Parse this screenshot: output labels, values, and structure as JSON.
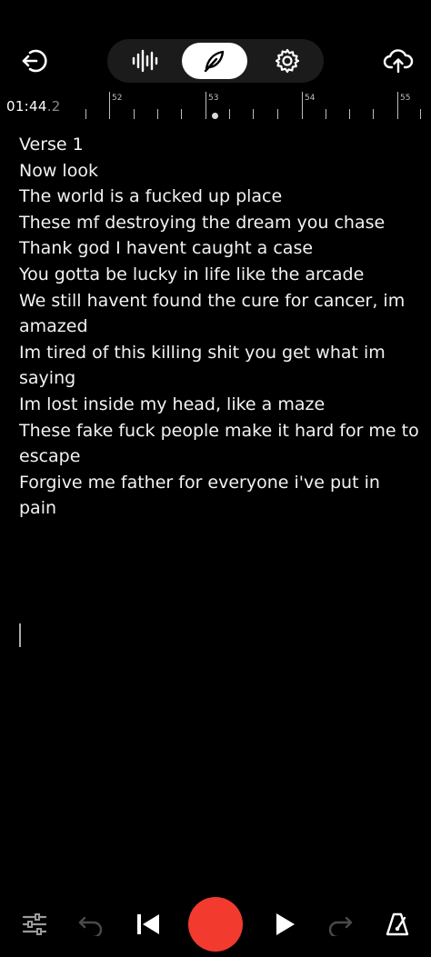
{
  "header": {
    "back_icon": "exit-arrow-icon",
    "modes": [
      {
        "name": "waveform-icon",
        "active": false
      },
      {
        "name": "feather-pen-icon",
        "active": true
      },
      {
        "name": "gear-icon",
        "active": false
      }
    ],
    "upload_icon": "cloud-upload-icon"
  },
  "timeline": {
    "time_main": "01:44",
    "time_fraction": ".2",
    "markers": [
      "52",
      "53",
      "54",
      "55"
    ]
  },
  "lyrics": {
    "lines": [
      "Verse 1",
      "Now look",
      "The world is a fucked up place",
      "These mf destroying the dream you chase",
      "Thank god I havent caught a case",
      "You gotta be lucky in life like the arcade",
      "We still havent found the cure for cancer, im amazed",
      "Im tired of this killing shit you get what im saying",
      "Im lost inside my head, like a maze",
      "These fake fuck people make it hard for me to escape",
      "Forgive me father for everyone i've put in pain"
    ]
  },
  "bottom": {
    "icons": [
      "sliders-icon",
      "undo-icon",
      "skip-back-icon",
      "record-button",
      "play-icon",
      "redo-icon",
      "metronome-icon"
    ],
    "record_color": "#f23a2f"
  }
}
